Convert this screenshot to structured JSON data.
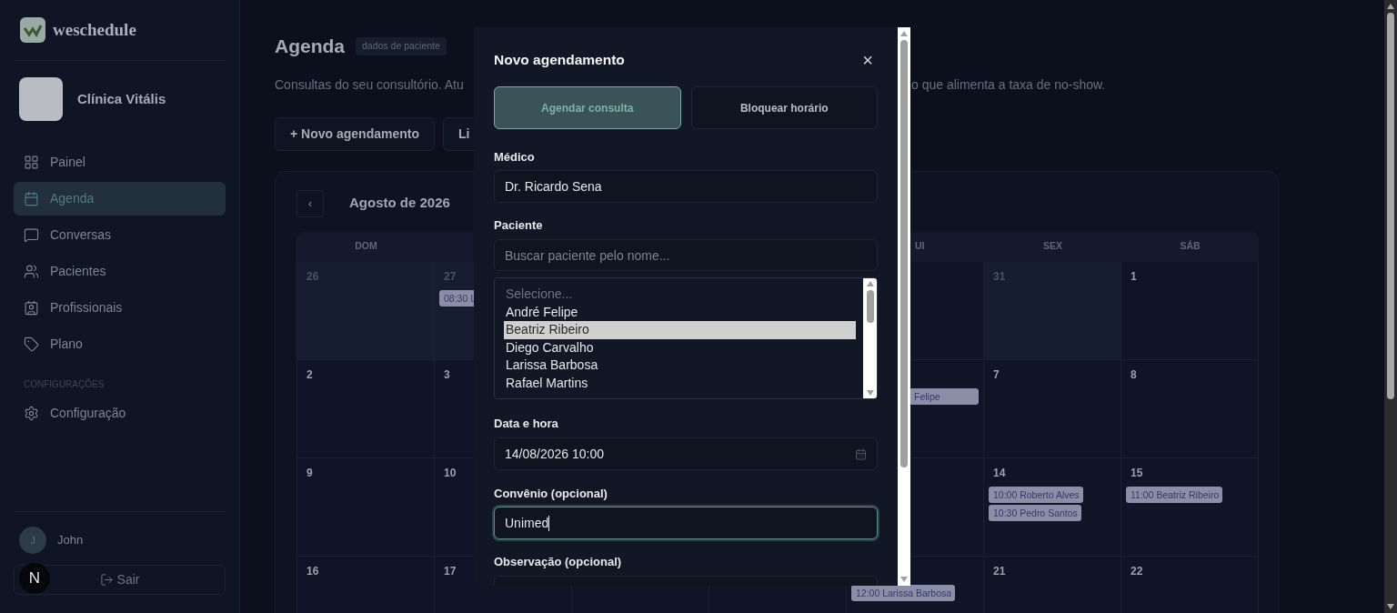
{
  "sidebar": {
    "brand": "weschedule",
    "clinic": {
      "name": "Clínica Vitális"
    },
    "nav": [
      {
        "label": "Painel",
        "selected": false
      },
      {
        "label": "Agenda",
        "selected": true
      },
      {
        "label": "Conversas",
        "selected": false
      },
      {
        "label": "Pacientes",
        "selected": false
      },
      {
        "label": "Profissionais",
        "selected": false
      },
      {
        "label": "Plano",
        "selected": false
      }
    ],
    "section_label": "CONFIGURAÇÕES",
    "settings_nav": [
      {
        "label": "Configuração",
        "selected": false
      }
    ],
    "user": {
      "initial": "J",
      "name": "John"
    },
    "logout": "Sair",
    "dev_badge": "N"
  },
  "page": {
    "title": "Agenda",
    "badge": "dados de paciente",
    "description_left": "Consultas do seu consultório. Atu",
    "description_right": "o que alimenta a taxa de no-show.",
    "actions": [
      "+ Novo agendamento",
      "Li"
    ]
  },
  "calendar": {
    "prev": "‹",
    "month": "Agosto de 2026",
    "weekdays": {
      "sunday": "DOM",
      "thursday": "UI",
      "friday": "SEX",
      "saturday": "SÁB"
    },
    "weeks": [
      {
        "sunday": {
          "day": "26",
          "outside": true
        },
        "monday": {
          "day": "27",
          "outside": true,
          "events": [
            {
              "text": "08:30 L",
              "cut_left": false
            }
          ]
        },
        "friday": {
          "day": "31",
          "outside": true
        },
        "saturday": {
          "day": "1",
          "outside": false
        }
      },
      {
        "sunday": {
          "day": "2",
          "outside": false
        },
        "monday": {
          "day": "3",
          "outside": false
        },
        "thursday": {
          "events": [
            {
              "text": "Felipe",
              "cut_left": true
            }
          ]
        },
        "friday": {
          "day": "7",
          "outside": false
        },
        "saturday": {
          "day": "8",
          "outside": false
        }
      },
      {
        "sunday": {
          "day": "9",
          "outside": false
        },
        "monday": {
          "day": "10",
          "outside": false
        },
        "friday": {
          "day": "14",
          "outside": false,
          "events": [
            {
              "text": "10:00 Roberto Alves",
              "cut_left": false
            },
            {
              "text": "10:30 Pedro Santos",
              "cut_left": false
            }
          ]
        },
        "saturday": {
          "day": "15",
          "outside": false,
          "events": [
            {
              "text": "11:00 Beatriz Ribeiro",
              "cut_left": false
            }
          ]
        }
      },
      {
        "sunday": {
          "day": "16",
          "outside": false
        },
        "monday": {
          "day": "17",
          "outside": false
        },
        "thursday": {
          "events": [
            {
              "text": "12:00 Larissa Barbosa",
              "cut_left": false
            }
          ]
        },
        "friday": {
          "day": "21",
          "outside": false
        },
        "saturday": {
          "day": "22",
          "outside": false
        }
      }
    ]
  },
  "modal": {
    "title": "Novo agendamento",
    "close": "×",
    "tabs": [
      {
        "label": "Agendar consulta",
        "selected": true
      },
      {
        "label": "Bloquear horário",
        "selected": false
      }
    ],
    "doctor": {
      "label": "Médico",
      "value": "Dr. Ricardo Sena"
    },
    "patient": {
      "label": "Paciente",
      "placeholder": "Buscar paciente pelo nome...",
      "options": [
        {
          "label": "Selecione...",
          "selected": false,
          "placeholder": true
        },
        {
          "label": "André Felipe",
          "selected": false,
          "placeholder": false
        },
        {
          "label": "Beatriz Ribeiro",
          "selected": true,
          "placeholder": false
        },
        {
          "label": "Diego Carvalho",
          "selected": false,
          "placeholder": false
        },
        {
          "label": "Larissa Barbosa",
          "selected": false,
          "placeholder": false
        },
        {
          "label": "Rafael Martins",
          "selected": false,
          "placeholder": false
        }
      ]
    },
    "datetime": {
      "label": "Data e hora",
      "value": "14/08/2026 10:00"
    },
    "insurance": {
      "label": "Convênio (opcional)",
      "value": "Unimed",
      "focused": true
    },
    "notes": {
      "label": "Observação (opcional)"
    }
  }
}
